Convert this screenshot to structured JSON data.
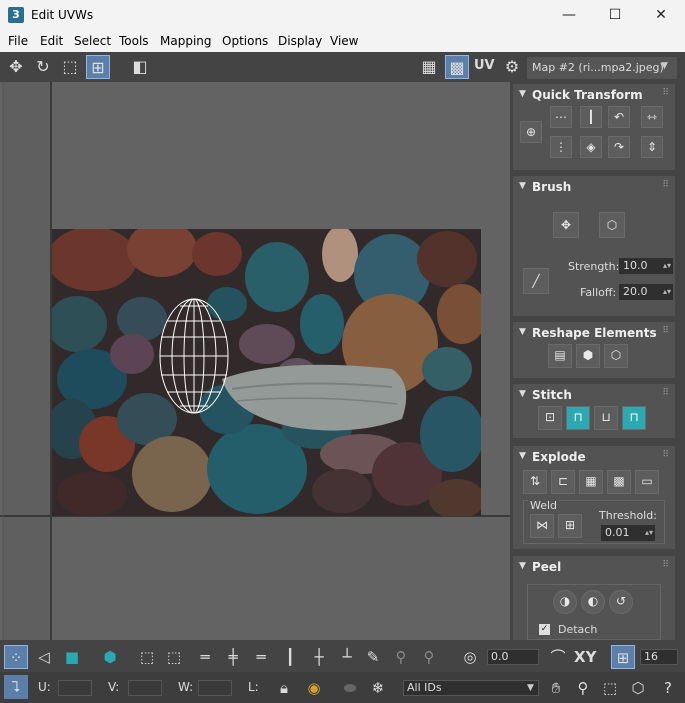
{
  "window": {
    "title": "Edit UVWs",
    "app_icon": "3",
    "minimize": "—",
    "maximize": "☐",
    "close": "✕"
  },
  "menu": [
    "File",
    "Edit",
    "Select",
    "Tools",
    "Mapping",
    "Options",
    "Display",
    "View"
  ],
  "toolbar": {
    "uv_label": "UV",
    "map_select": "Map #2 (ri...mpa2.jpeg)"
  },
  "panel": {
    "quick_transform": {
      "title": "Quick Transform"
    },
    "brush": {
      "title": "Brush",
      "strength_label": "Strength:",
      "strength_value": "10.0",
      "falloff_label": "Falloff:",
      "falloff_value": "20.0"
    },
    "reshape": {
      "title": "Reshape Elements"
    },
    "stitch": {
      "title": "Stitch"
    },
    "explode": {
      "title": "Explode",
      "weld_label": "Weld",
      "threshold_label": "Threshold:",
      "threshold_value": "0.01"
    },
    "peel": {
      "title": "Peel",
      "detach_label": "Detach",
      "detach_checked": true
    }
  },
  "bottom": {
    "angle_value": "0.0",
    "xy_label": "XY",
    "grid_value": "16",
    "u_label": "U:",
    "v_label": "V:",
    "w_label": "W:",
    "l_label": "L:",
    "ids_select": "All IDs"
  },
  "colors": {
    "accent": "#2aa9b3",
    "panel_bg": "#444444",
    "viewport_bg": "#636363"
  }
}
